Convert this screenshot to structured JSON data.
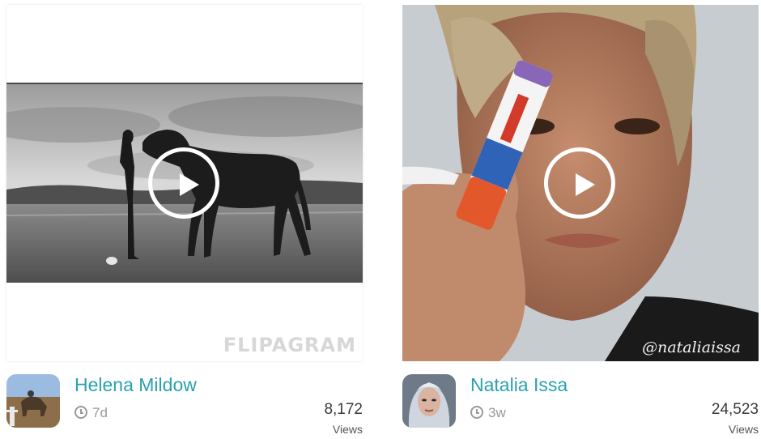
{
  "cards": [
    {
      "user": "Helena Mildow",
      "age": "7d",
      "views": "8,172",
      "views_label": "Views",
      "watermark": "FLIPAGRAM"
    },
    {
      "user": "Natalia Issa",
      "age": "3w",
      "views": "24,523",
      "views_label": "Views",
      "watermark": "@nataliaissa"
    }
  ],
  "icons": {
    "play": "play-icon",
    "clock": "clock-icon"
  }
}
